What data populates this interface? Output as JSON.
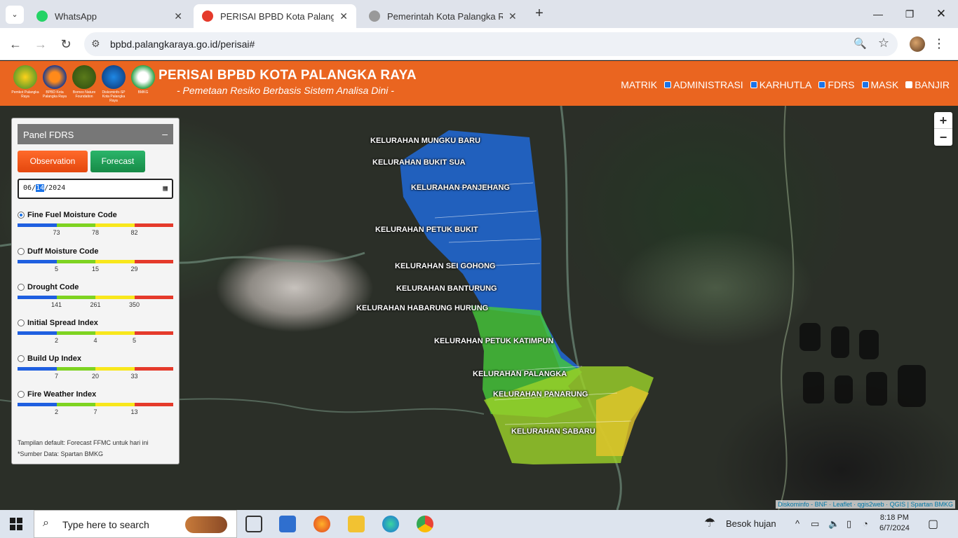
{
  "browser": {
    "tabs": [
      {
        "label": "WhatsApp",
        "active": false
      },
      {
        "label": "PERISAI BPBD Kota Palangka Ra",
        "active": true
      },
      {
        "label": "Pemerintah Kota Palangka Raya",
        "active": false
      }
    ],
    "url": "bpbd.palangkaraya.go.id/perisai#"
  },
  "site": {
    "title": "PERISAI BPBD KOTA PALANGKA RAYA",
    "subtitle": "- Pemetaan Resiko Berbasis Sistem Analisa Dini -",
    "logos": [
      {
        "caption": "Pemkot Palangka Raya"
      },
      {
        "caption": "BPBD Kota Palangka Raya"
      },
      {
        "caption": "Borneo Nature Foundation"
      },
      {
        "caption": "Diskominfo-SP Kota Palangka Raya"
      },
      {
        "caption": "BMKG"
      }
    ],
    "nav": [
      {
        "label": "MATRIK",
        "checkbox": false,
        "checked": false
      },
      {
        "label": "ADMINISTRASI",
        "checkbox": true,
        "checked": true
      },
      {
        "label": "KARHUTLA",
        "checkbox": true,
        "checked": true
      },
      {
        "label": "FDRS",
        "checkbox": true,
        "checked": true
      },
      {
        "label": "MASK",
        "checkbox": true,
        "checked": true
      },
      {
        "label": "BANJIR",
        "checkbox": true,
        "checked": false
      }
    ]
  },
  "panel": {
    "title": "Panel FDRS",
    "minimize": "–",
    "observation_label": "Observation",
    "forecast_label": "Forecast",
    "date": {
      "month": "06",
      "day": "14",
      "year": "2024"
    },
    "indices": [
      {
        "name": "Fine Fuel Moisture Code",
        "selected": true,
        "ticks": [
          "73",
          "78",
          "82"
        ]
      },
      {
        "name": "Duff Moisture Code",
        "selected": false,
        "ticks": [
          "5",
          "15",
          "29"
        ]
      },
      {
        "name": "Drought Code",
        "selected": false,
        "ticks": [
          "141",
          "261",
          "350"
        ]
      },
      {
        "name": "Initial Spread Index",
        "selected": false,
        "ticks": [
          "2",
          "4",
          "5"
        ]
      },
      {
        "name": "Build Up Index",
        "selected": false,
        "ticks": [
          "7",
          "20",
          "33"
        ]
      },
      {
        "name": "Fire Weather Index",
        "selected": false,
        "ticks": [
          "2",
          "7",
          "13"
        ]
      }
    ],
    "scale_colors": [
      "#1f5fe0",
      "#7ed321",
      "#f8e71c",
      "#e53a2b"
    ],
    "note": "Tampilan default: Forecast FFMC untuk hari ini",
    "source": "*Sumber Data: Spartan BMKG"
  },
  "map": {
    "regions": [
      "KELURAHAN MUNGKU BARU",
      "KELURAHAN BUKIT SUA",
      "KELURAHAN PANJEHANG",
      "KELURAHAN PETUK BUKIT",
      "KELURAHAN SEI GOHONG",
      "KELURAHAN BANTURUNG",
      "KELURAHAN HABARUNG HURUNG",
      "KELURAHAN PETUK KATIMPUN",
      "KELURAHAN PALANGKA",
      "KELURAHAN PANARUNG",
      "KELURAHAN SABARU"
    ],
    "zoom_in": "+",
    "zoom_out": "−",
    "attribution": "Diskominfo - BNF · Leaflet · qgis2web · QGIS | Spartan BMKG"
  },
  "taskbar": {
    "search_placeholder": "Type here to search",
    "weather": "Besok hujan",
    "time": "8:18 PM",
    "date": "6/7/2024"
  }
}
